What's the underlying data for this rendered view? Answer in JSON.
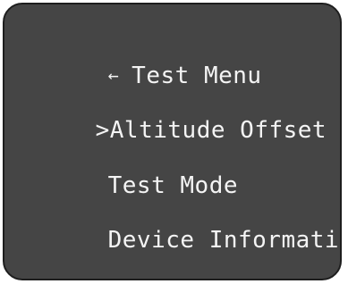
{
  "menu": {
    "back_icon": "←",
    "title": "Test Menu",
    "cursor": ">",
    "items": [
      {
        "label": "Altitude Offset",
        "selected": true
      },
      {
        "label": "Test Mode",
        "selected": false
      },
      {
        "label": "Device Information",
        "selected": false
      }
    ]
  }
}
